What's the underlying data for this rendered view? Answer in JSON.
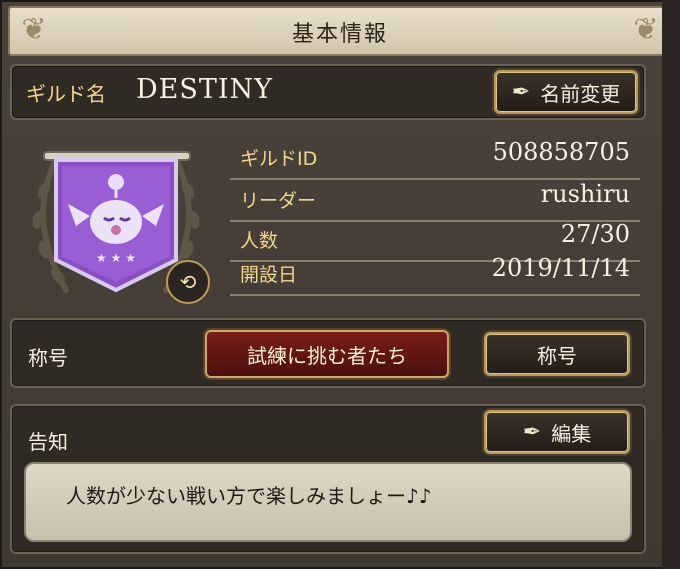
{
  "header": {
    "title": "基本情報"
  },
  "guild": {
    "name_label": "ギルド名",
    "name": "DESTINY",
    "rename_label": "名前変更"
  },
  "info": [
    {
      "key": "ギルドID",
      "value": "508858705"
    },
    {
      "key": "リーダー",
      "value": "rushiru"
    },
    {
      "key": "人数",
      "value": "27/30"
    },
    {
      "key": "開設日",
      "value": "2019/11/14"
    }
  ],
  "emblem": {
    "icon": "moogle-banner-icon",
    "swap_icon": "swap-icon",
    "color": "#8a4fc2"
  },
  "title_section": {
    "label": "称号",
    "current_title": "試練に挑む者たち",
    "button_label": "称号"
  },
  "notice": {
    "label": "告知",
    "edit_label": "編集",
    "text": "人数が少ない戦い方で楽しみましょー♪♪"
  },
  "colors": {
    "gold_label": "#f3d58e",
    "title_badge": "#7a1e1a"
  }
}
